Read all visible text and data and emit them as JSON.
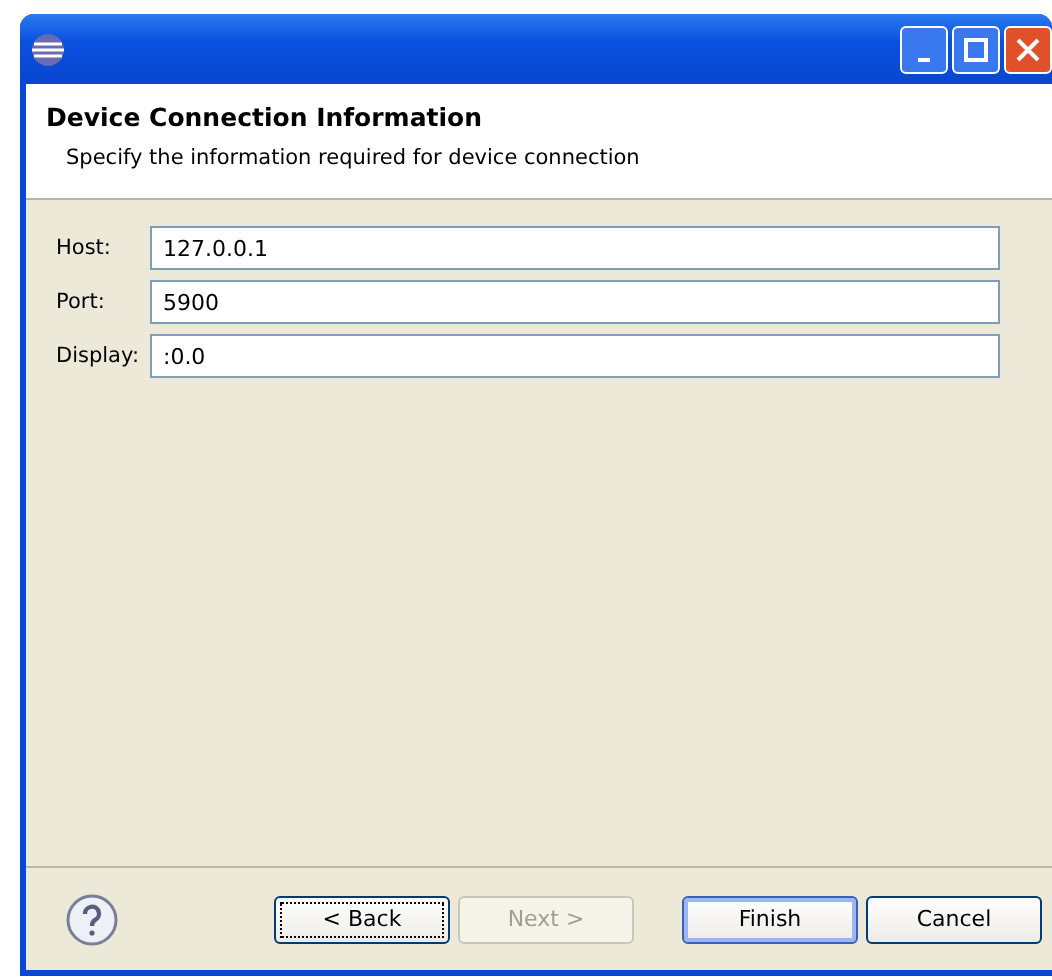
{
  "header": {
    "title": "Device Connection Information",
    "description": "Specify the information required for device connection"
  },
  "fields": [
    {
      "label": "Host:",
      "value": "127.0.0.1"
    },
    {
      "label": "Port:",
      "value": "5900"
    },
    {
      "label": "Display:",
      "value": ":0.0"
    }
  ],
  "buttons": [
    {
      "label": "< Back",
      "disabled": false,
      "focused": true,
      "default": false
    },
    {
      "label": "Next >",
      "disabled": true,
      "focused": false,
      "default": false
    },
    {
      "label": "Finish",
      "disabled": false,
      "focused": false,
      "default": true
    },
    {
      "label": "Cancel",
      "disabled": false,
      "focused": false,
      "default": false
    }
  ]
}
